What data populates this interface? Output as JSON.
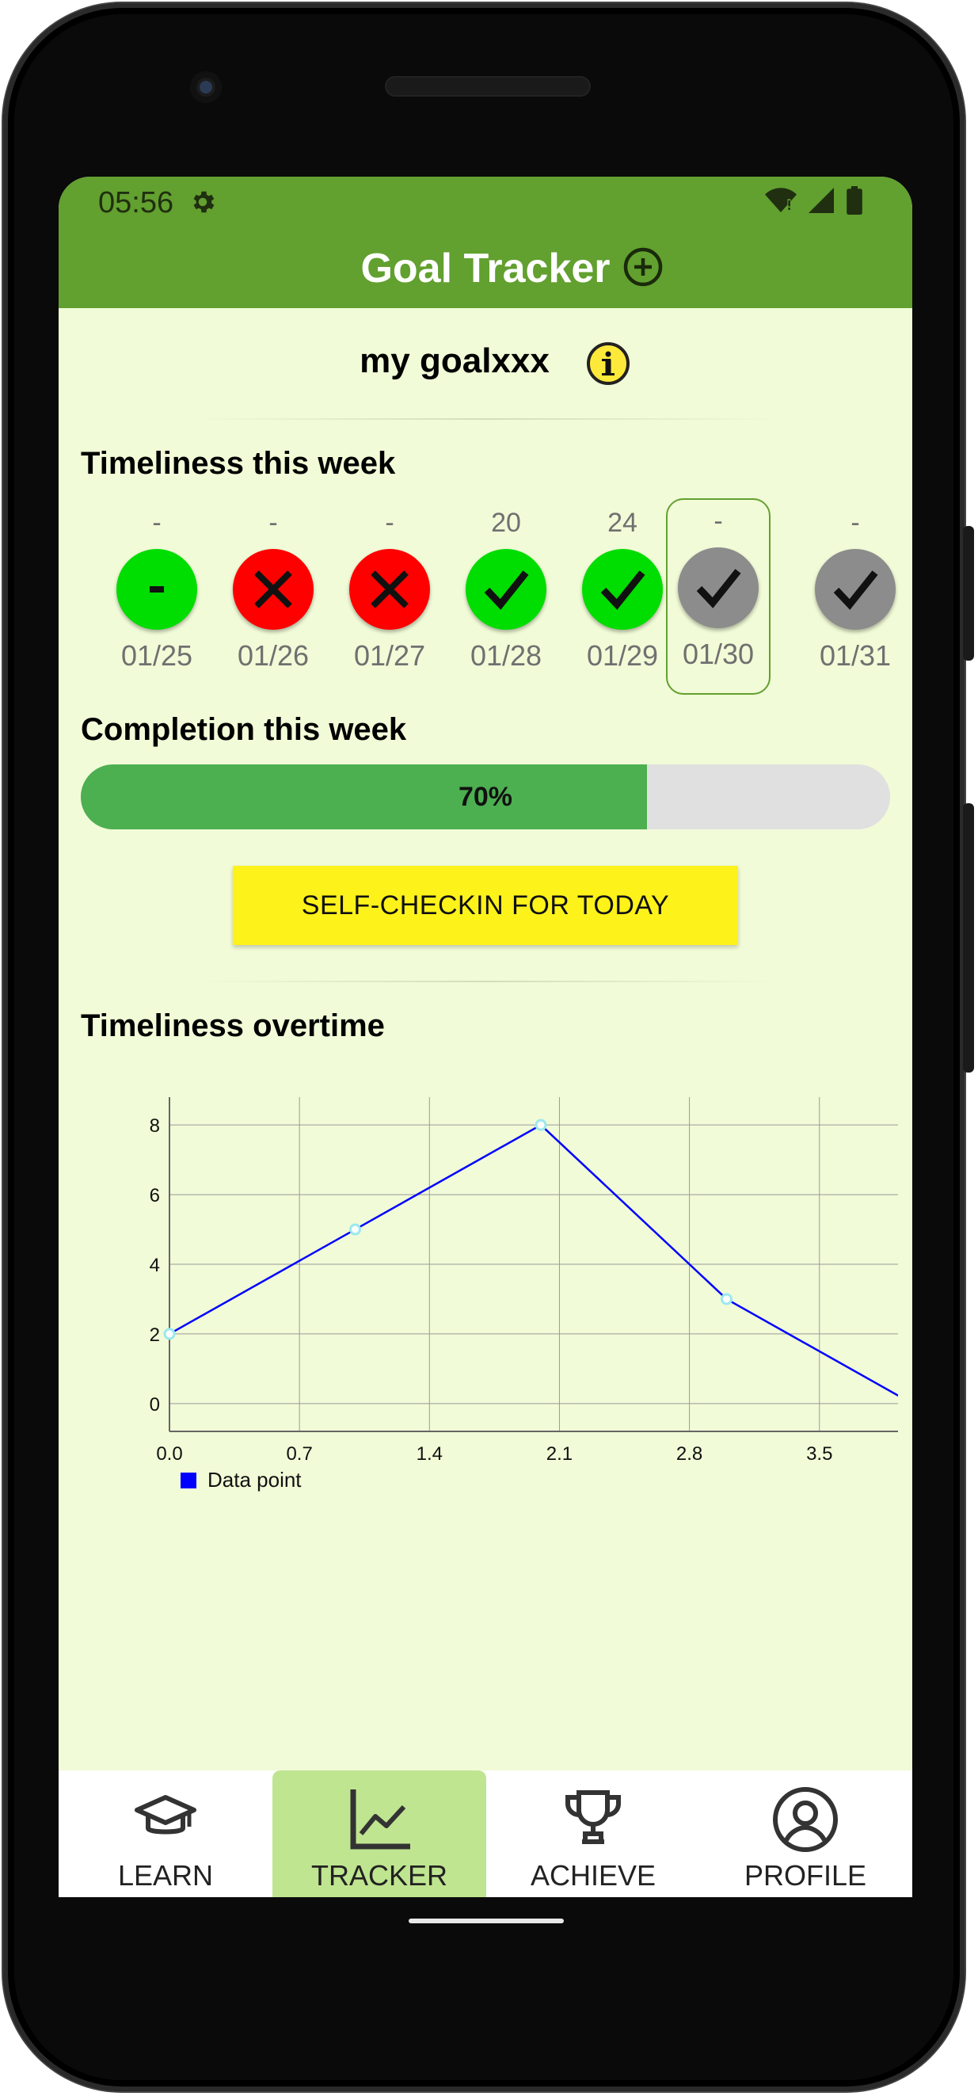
{
  "status_bar": {
    "time": "05:56"
  },
  "app_bar": {
    "title": "Goal Tracker"
  },
  "goal": {
    "name": "my goalxxx"
  },
  "timeliness_week": {
    "title": "Timeliness this week",
    "days": [
      {
        "value": "-",
        "date": "01/25",
        "status": "neutral"
      },
      {
        "value": "-",
        "date": "01/26",
        "status": "missed"
      },
      {
        "value": "-",
        "date": "01/27",
        "status": "missed"
      },
      {
        "value": "20",
        "date": "01/28",
        "status": "done"
      },
      {
        "value": "24",
        "date": "01/29",
        "status": "done"
      },
      {
        "value": "-",
        "date": "01/30",
        "status": "pending"
      },
      {
        "value": "-",
        "date": "01/31",
        "status": "pending"
      }
    ]
  },
  "completion": {
    "title": "Completion this week",
    "percent": 70,
    "label": "70%"
  },
  "checkin_button": {
    "label": "SELF-CHECKIN FOR TODAY"
  },
  "timeliness_overtime": {
    "title": "Timeliness overtime"
  },
  "chart_data": {
    "type": "line",
    "x": [
      0,
      1,
      2,
      3,
      4
    ],
    "series": [
      {
        "name": "Data point",
        "values": [
          2,
          5,
          8,
          3,
          0
        ]
      }
    ],
    "x_ticks": [
      "0.0",
      "0.7",
      "1.4",
      "2.1",
      "2.8",
      "3.5"
    ],
    "y_ticks": [
      "0",
      "2",
      "4",
      "6",
      "8"
    ],
    "xlim": [
      0,
      4
    ],
    "ylim": [
      -0.8,
      8.8
    ],
    "grid": true,
    "legend": "bottom-left",
    "colors": {
      "line": "#0000ff",
      "marker": "#9be8ee"
    }
  },
  "nav": {
    "items": [
      {
        "label": "LEARN",
        "icon": "graduation-cap-icon"
      },
      {
        "label": "TRACKER",
        "icon": "chart-line-icon"
      },
      {
        "label": "ACHIEVE",
        "icon": "trophy-icon"
      },
      {
        "label": "PROFILE",
        "icon": "profile-icon"
      }
    ],
    "active": "TRACKER"
  },
  "colors": {
    "app_bar": "#62a02f",
    "background": "#f1fbd7",
    "done": "#00dd00",
    "missed": "#ff0000",
    "pending": "#8c8c8c",
    "progress": "#4caf50",
    "button": "#fdf21a"
  }
}
